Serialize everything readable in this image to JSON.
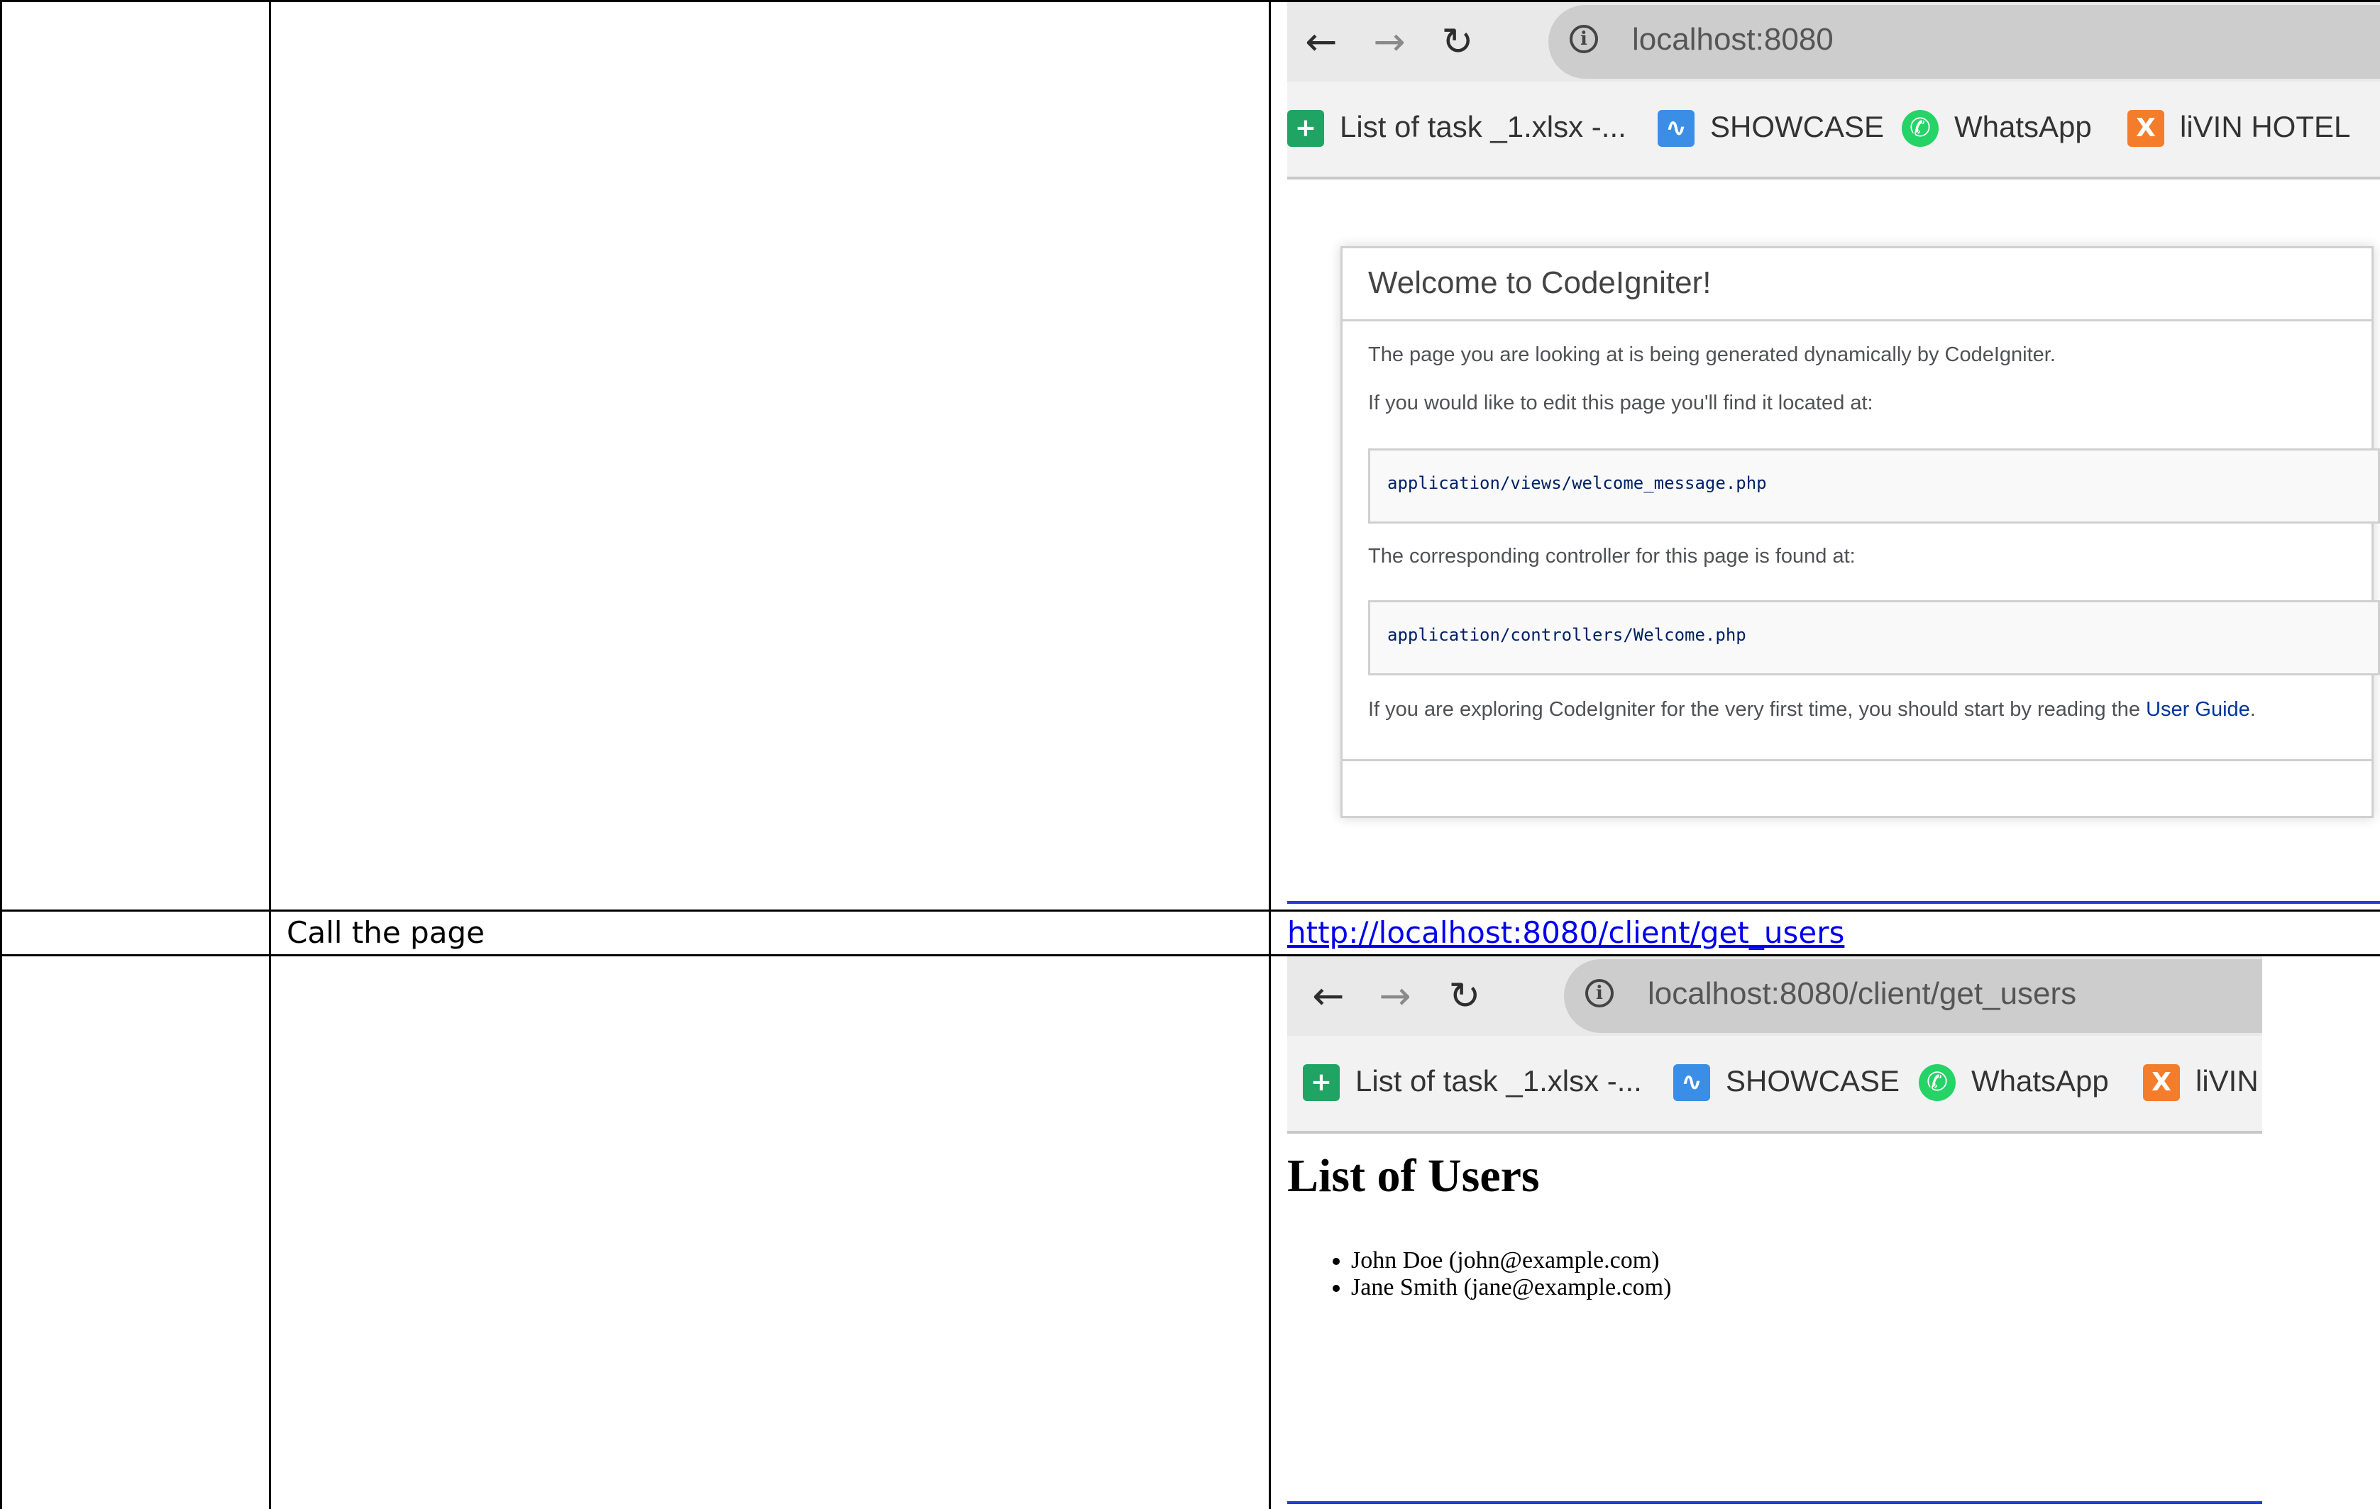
{
  "table": {
    "row2_label": "Call the page",
    "row2_url": "http://localhost:8080/client/get_users"
  },
  "screenshot1": {
    "nav": {
      "back_icon": "←",
      "forward_icon": "→",
      "reload_icon": "↻",
      "info_icon": "i"
    },
    "url": "localhost:8080",
    "bookmarks": [
      {
        "label": "List of task _1.xlsx -...",
        "icon": "sheets-icon",
        "glyph": "+",
        "color": "#20a464"
      },
      {
        "label": "SHOWCASE",
        "icon": "showcase-icon",
        "glyph": "∿",
        "color": "#3a8ee6"
      },
      {
        "label": "WhatsApp",
        "icon": "whatsapp-icon",
        "glyph": "✆",
        "color": "#25d366"
      },
      {
        "label": "liVIN HOTEL",
        "icon": "xampp-icon",
        "glyph": "X",
        "color": "#f47d2b"
      }
    ],
    "card": {
      "title": "Welcome to CodeIgniter!",
      "p1": "The page you are looking at is being generated dynamically by CodeIgniter.",
      "p2": "If you would like to edit this page you'll find it located at:",
      "code1": "application/views/welcome_message.php",
      "p3": "The corresponding controller for this page is found at:",
      "code2": "application/controllers/Welcome.php",
      "p4_prefix": "If you are exploring CodeIgniter for the very first time, you should start by reading the ",
      "p4_link": "User Guide",
      "p4_suffix": "."
    }
  },
  "screenshot2": {
    "nav": {
      "back_icon": "←",
      "forward_icon": "→",
      "reload_icon": "↻",
      "info_icon": "i"
    },
    "url": "localhost:8080/client/get_users",
    "bookmarks": [
      {
        "label": "List of task _1.xlsx -...",
        "icon": "sheets-icon",
        "glyph": "+",
        "color": "#20a464"
      },
      {
        "label": "SHOWCASE",
        "icon": "showcase-icon",
        "glyph": "∿",
        "color": "#3a8ee6"
      },
      {
        "label": "WhatsApp",
        "icon": "whatsapp-icon",
        "glyph": "✆",
        "color": "#25d366"
      },
      {
        "label": "liVIN",
        "icon": "xampp-icon",
        "glyph": "X",
        "color": "#f47d2b"
      }
    ],
    "heading": "List of Users",
    "users": [
      "John Doe (john@example.com)",
      "Jane Smith (jane@example.com)"
    ]
  }
}
